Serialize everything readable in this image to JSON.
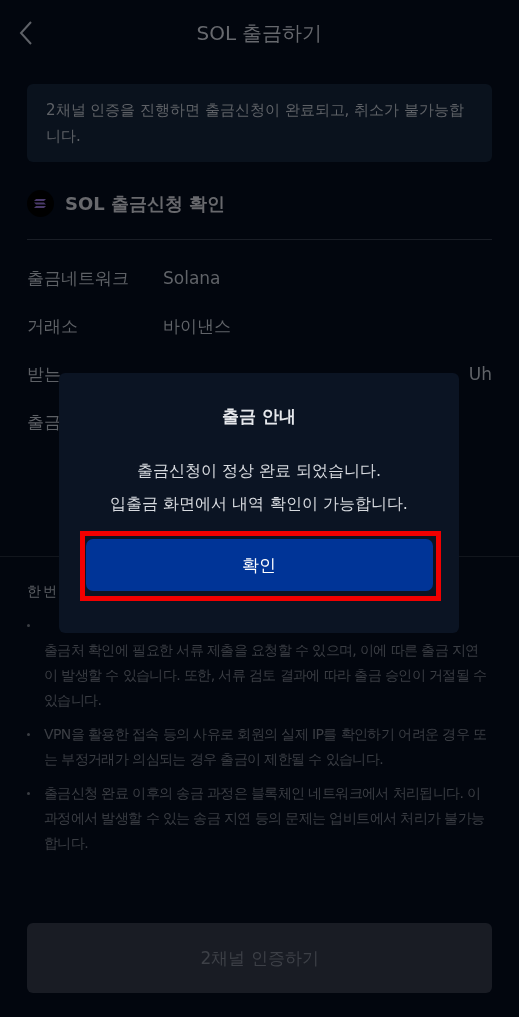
{
  "header": {
    "title": "SOL 출금하기"
  },
  "notice": "2채널 인증을 진행하면 출금신청이 완료되고, 취소가 불가능합니다.",
  "summary": {
    "title": "SOL 출금신청 확인",
    "rows": [
      {
        "label": "출금네트워크",
        "value": "Solana",
        "kind": "plain"
      },
      {
        "label": "거래소",
        "value": "바이낸스",
        "kind": "plain"
      },
      {
        "label": "받는",
        "value": "Uh",
        "kind": "covered"
      },
      {
        "label": "출금"
      }
    ]
  },
  "info": {
    "title": "한 번",
    "items": [
      {
        "text": "출금처 확인에 필요한 서류 제출을 요청할 수 있으며, 이에 따른 출금 지연이 발생할 수 있습니다. 또한, 서류 검토 결과에 따라 출금 승인이 거절될 수 있습니다.",
        "kind": "covered"
      },
      {
        "text": "VPN을 활용한 접속 등의 사유로 회원의 실제 IP를 확인하기 어려운 경우 또는 부정거래가 의심되는 경우 출금이 제한될 수 있습니다.",
        "kind": "plain"
      },
      {
        "text": "출금신청 완료 이후의 송금 과정은 블록체인 네트워크에서 처리됩니다. 이 과정에서 발생할 수 있는 송금 지연 등의 문제는 업비트에서 처리가 불가능합니다.",
        "kind": "plain"
      }
    ]
  },
  "submit": {
    "label": "2채널 인증하기",
    "disabled": true
  },
  "dialog": {
    "title": "출금 안내",
    "message": [
      "출금신청이 정상 완료 되었습니다.",
      "입출금 화면에서 내역 확인이 가능합니다."
    ],
    "button": "확인",
    "highlighted": true
  }
}
